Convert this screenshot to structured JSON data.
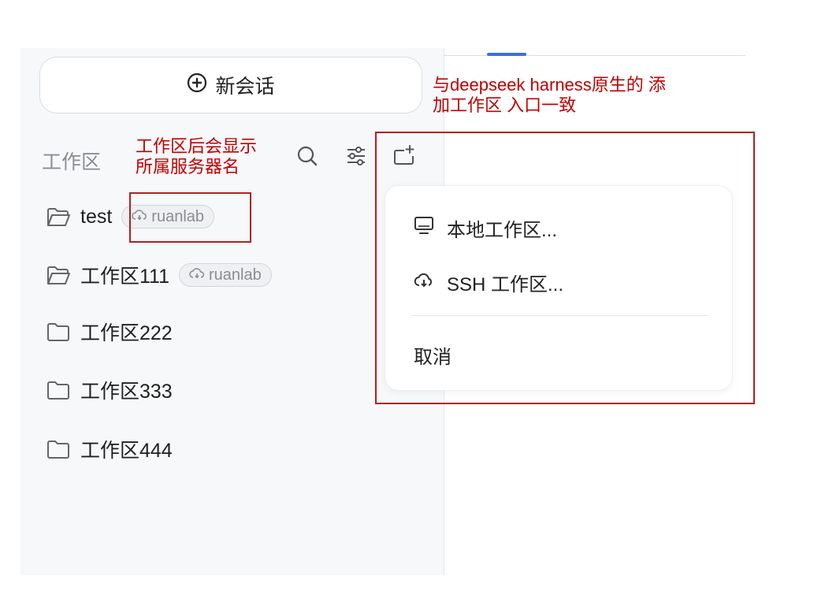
{
  "header": {
    "new_chat_label": "新会话"
  },
  "workspace": {
    "title": "工作区",
    "items": [
      {
        "name": "test",
        "server": "ruanlab",
        "icon": "folder-open-icon"
      },
      {
        "name": "工作区111",
        "server": "ruanlab",
        "icon": "folder-open-icon"
      },
      {
        "name": "工作区222",
        "icon": "folder-icon"
      },
      {
        "name": "工作区333",
        "icon": "folder-icon"
      },
      {
        "name": "工作区444",
        "icon": "folder-icon"
      }
    ]
  },
  "menu": {
    "local_label": "本地工作区...",
    "ssh_label": "SSH 工作区...",
    "cancel_label": "取消"
  },
  "annotations": {
    "server_note_line1": "工作区后会显示",
    "server_note_line2": "所属服务器名",
    "entry_note_line1": "与deepseek harness原生的 添",
    "entry_note_line2": "加工作区 入口一致"
  },
  "colors": {
    "accent": "#3b6fe0",
    "annotation": "#c00000",
    "sidebar_bg": "#f7f8fa"
  }
}
